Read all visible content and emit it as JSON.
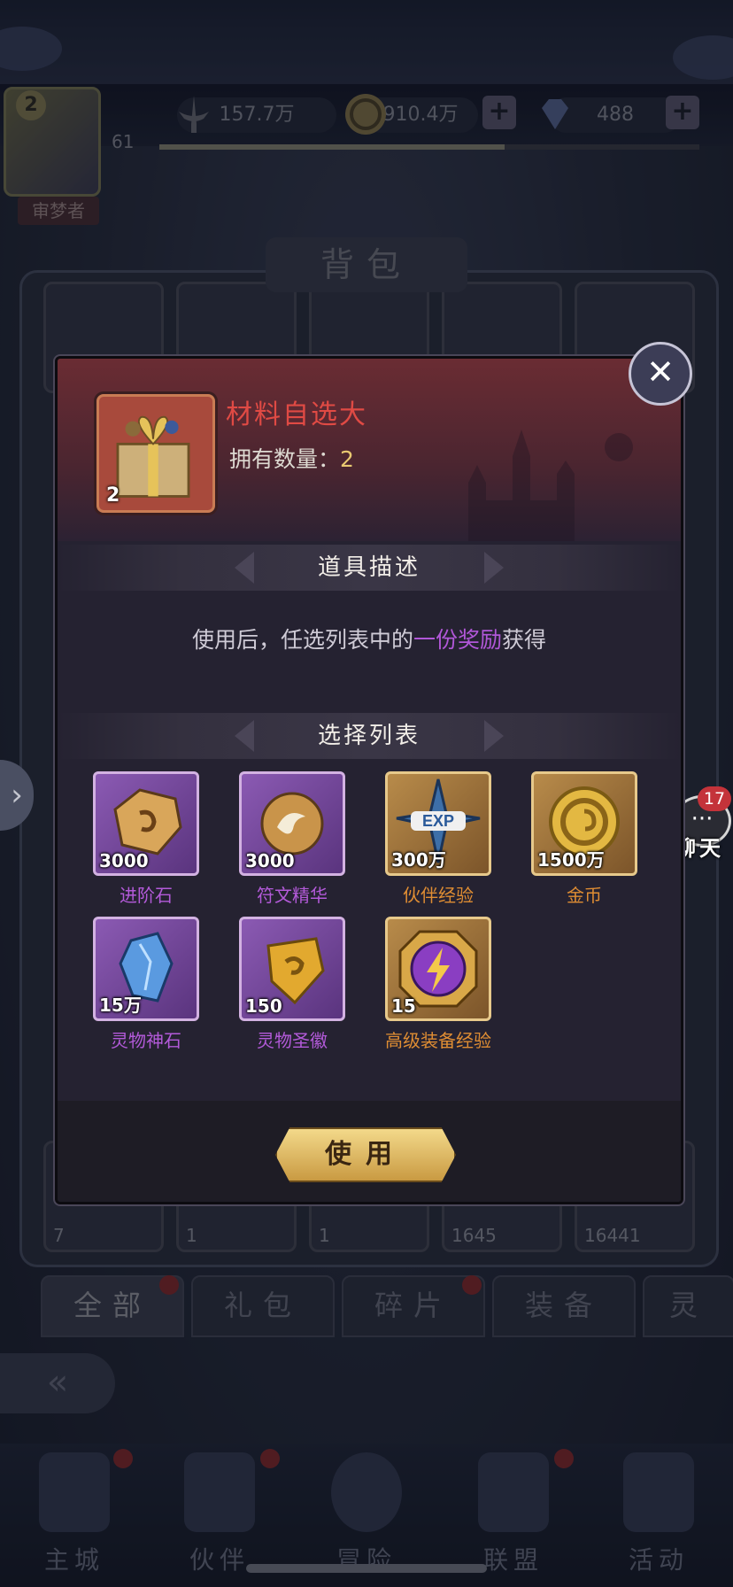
{
  "header": {
    "power": "157.7万",
    "gold": "910.4万",
    "gems": "488",
    "plus_label": "+",
    "player_level": "61",
    "avatar_level": "2",
    "player_title": "审梦者",
    "xp_progress": 0.64
  },
  "bag": {
    "title": "背包",
    "counts": [
      "7",
      "1",
      "1",
      "1645",
      "16441"
    ],
    "top_badge": "2"
  },
  "categories": [
    "全部",
    "礼包",
    "碎片",
    "装备",
    "灵"
  ],
  "bottom_nav": [
    "主城",
    "伙伴",
    "冒险",
    "联盟",
    "活动"
  ],
  "chat": {
    "label": "聊天",
    "badge": "17"
  },
  "modal": {
    "item_name": "材料自选大",
    "item_qty": "2",
    "own_label": "拥有数量：",
    "own_value": "2",
    "desc_title": "道具描述",
    "desc_prefix": "使用后，任选列表中的",
    "desc_highlight": "一份奖励",
    "desc_suffix": "获得",
    "list_title": "选择列表",
    "use_label": "使用",
    "rewards": [
      {
        "name": "进阶石",
        "amount": "3000",
        "frame": "purple",
        "icon": "advance-stone-icon"
      },
      {
        "name": "符文精华",
        "amount": "3000",
        "frame": "purple",
        "icon": "rune-essence-icon"
      },
      {
        "name": "伙伴经验",
        "amount": "300万",
        "frame": "gold",
        "icon": "exp-star-icon"
      },
      {
        "name": "金币",
        "amount": "1500万",
        "frame": "gold",
        "icon": "gold-coin-icon"
      },
      {
        "name": "灵物神石",
        "amount": "15万",
        "frame": "purple",
        "icon": "blue-crystal-icon"
      },
      {
        "name": "灵物圣徽",
        "amount": "150",
        "frame": "purple",
        "icon": "holy-emblem-icon"
      },
      {
        "name": "高级装备经验",
        "amount": "15",
        "frame": "gold",
        "icon": "lightning-badge-icon"
      }
    ]
  }
}
